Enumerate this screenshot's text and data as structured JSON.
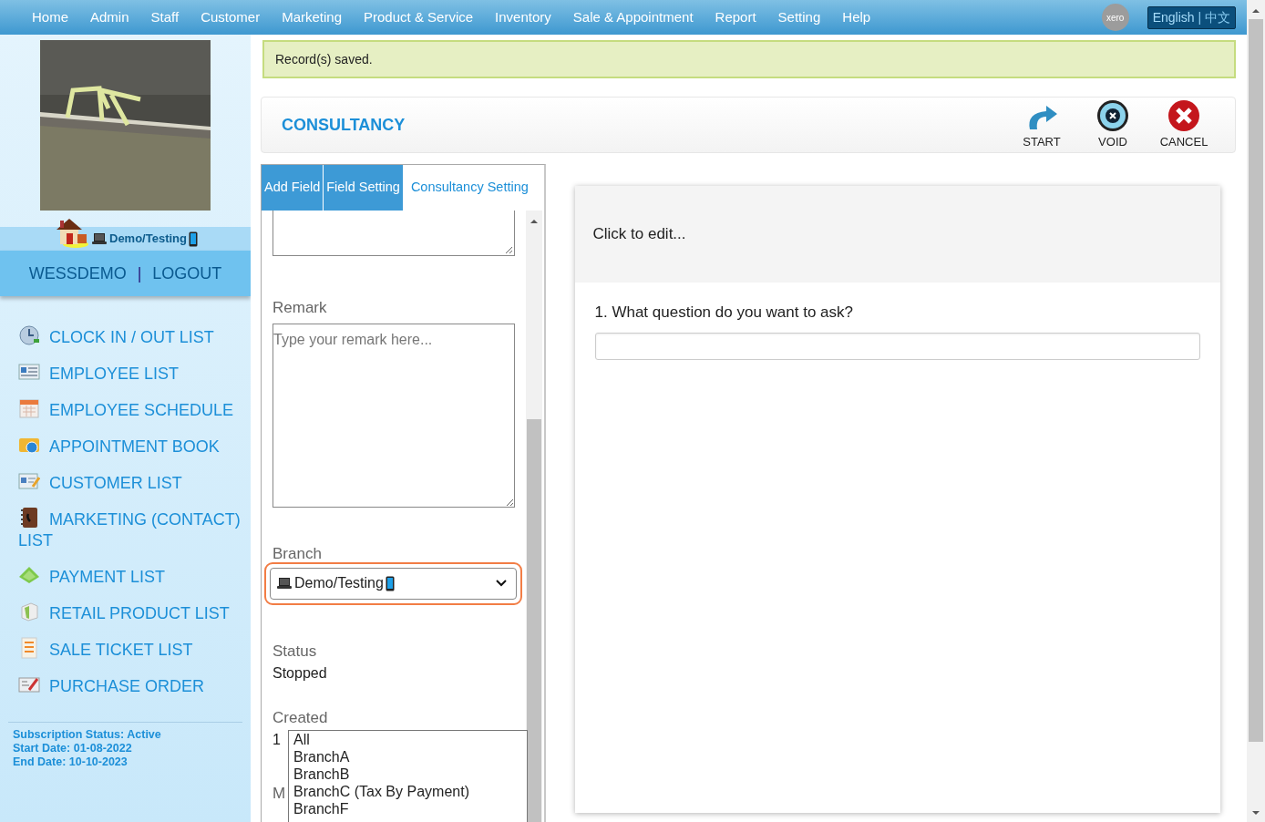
{
  "nav": {
    "items": [
      "Home",
      "Admin",
      "Staff",
      "Customer",
      "Marketing",
      "Product & Service",
      "Inventory",
      "Sale & Appointment",
      "Report",
      "Setting",
      "Help"
    ],
    "xero": "xero",
    "language": {
      "options": [
        {
          "label": "English",
          "selected": true
        },
        {
          "label": "中文",
          "selected": false
        }
      ],
      "separator": "|"
    }
  },
  "sidebar": {
    "branch": "Demo/Testing",
    "user": "WESSDEMO",
    "separator": "|",
    "logout": "LOGOUT",
    "menu": [
      {
        "label": "CLOCK IN / OUT LIST"
      },
      {
        "label": "EMPLOYEE LIST"
      },
      {
        "label": "EMPLOYEE SCHEDULE"
      },
      {
        "label": "APPOINTMENT BOOK"
      },
      {
        "label": "CUSTOMER LIST"
      },
      {
        "label": "MARKETING (CONTACT) LIST"
      },
      {
        "label": "PAYMENT LIST"
      },
      {
        "label": "RETAIL PRODUCT LIST"
      },
      {
        "label": "SALE TICKET LIST"
      },
      {
        "label": "PURCHASE ORDER"
      }
    ],
    "subscription": [
      "Subscription Status: Active",
      "Start Date: 01-08-2022",
      "End Date: 10-10-2023"
    ]
  },
  "alert": "Record(s) saved.",
  "header": {
    "title": "CONSULTANCY",
    "actions": [
      {
        "kind": "start",
        "label": "START"
      },
      {
        "kind": "void",
        "label": "VOID"
      },
      {
        "kind": "cancel",
        "label": "CANCEL"
      }
    ]
  },
  "tabs": [
    {
      "label": "Add Field",
      "selected": false
    },
    {
      "label": "Field Setting",
      "selected": false
    },
    {
      "label": "Consultancy Setting",
      "selected": true
    }
  ],
  "form": {
    "remark": {
      "label": "Remark",
      "placeholder": "Type your remark here..."
    },
    "branch": {
      "label": "Branch",
      "value": "Demo/Testing",
      "focused": true
    },
    "status": {
      "label": "Status",
      "value": "Stopped"
    },
    "created": {
      "label": "Created",
      "value": "1"
    },
    "next_label": "M"
  },
  "branch_list": {
    "options": [
      "All",
      "BranchA",
      "BranchB",
      "BranchC (Tax By Payment)",
      "BranchF"
    ]
  },
  "survey": {
    "header": "Click to edit...",
    "questions": [
      {
        "number": "1.",
        "text": "What question do you want to ask?"
      }
    ]
  }
}
